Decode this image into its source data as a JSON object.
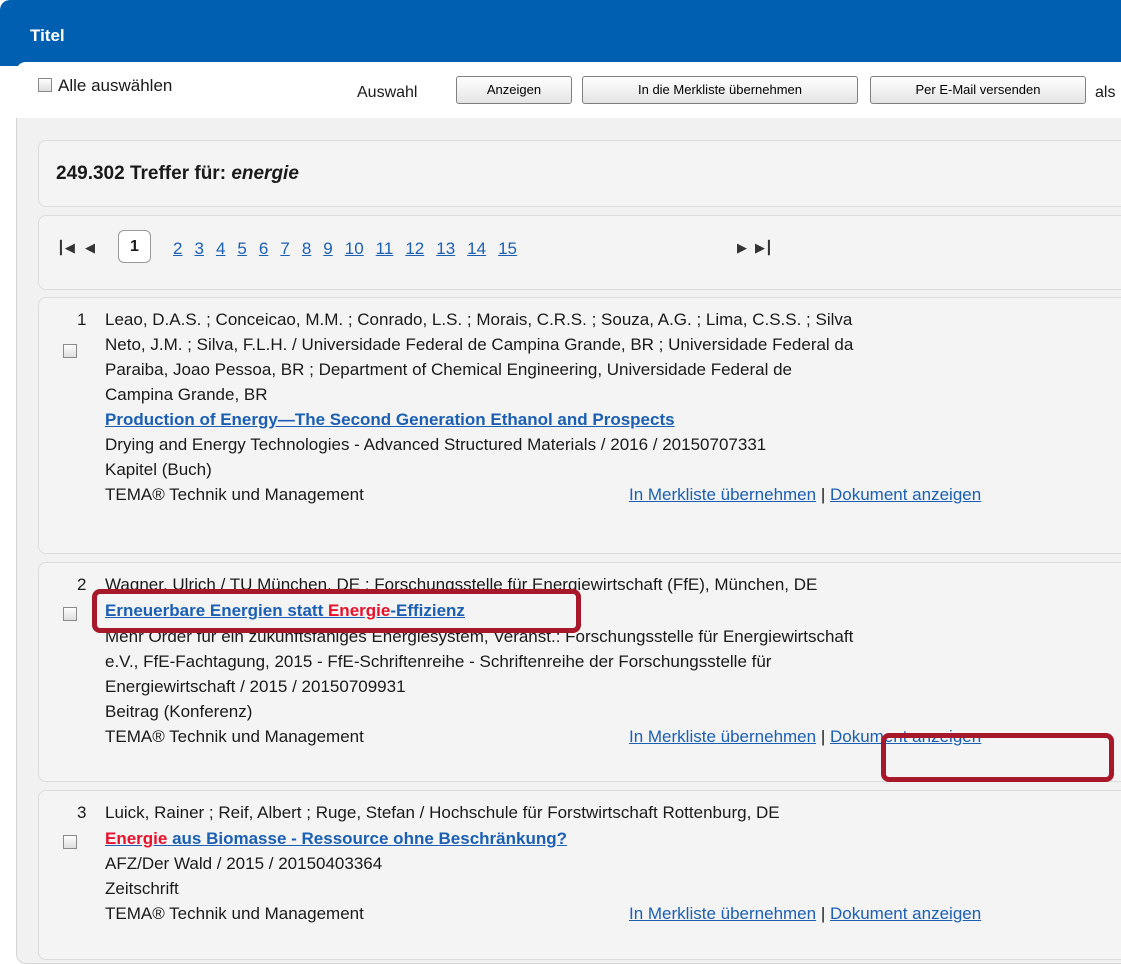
{
  "header": {
    "title": "Titel"
  },
  "toolbar": {
    "select_all_label": "Alle auswählen",
    "selection_label": "Auswahl",
    "show_button": "Anzeigen",
    "add_to_list_button": "In die Merkliste übernehmen",
    "email_button": "Per E-Mail versenden",
    "trailing_text": "als"
  },
  "search": {
    "hits_text": "249.302 Treffer für: ",
    "query": "energie"
  },
  "pagination": {
    "current": "1",
    "pages": [
      "2",
      "3",
      "4",
      "5",
      "6",
      "7",
      "8",
      "9",
      "10",
      "11",
      "12",
      "13",
      "14",
      "15"
    ],
    "first_icon": "first-page-icon",
    "prev_icon": "prev-page-icon",
    "next_icon": "next-page-icon",
    "last_icon": "last-page-icon"
  },
  "results": [
    {
      "number": "1",
      "authors_line1": "Leao, D.A.S. ; Conceicao, M.M. ; Conrado, L.S. ; Morais, C.R.S. ; Souza, A.G. ; Lima, C.S.S. ; Silva",
      "authors_line2": "Neto, J.M. ; Silva, F.L.H. / Universidade Federal de Campina Grande, BR ; Universidade Federal da",
      "authors_line3": "Paraiba, Joao Pessoa, BR ; Department of Chemical Engineering, Universidade Federal de",
      "authors_line4": "Campina Grande, BR",
      "title": "Production of Energy—The Second Generation Ethanol and Prospects",
      "source": "Drying and Energy Technologies - Advanced Structured Materials / 2016 / 20150707331",
      "doc_type": "Kapitel (Buch)",
      "database": "TEMA® Technik und Management",
      "add_link": "In Merkliste übernehmen",
      "separator": "|",
      "show_link": "Dokument anzeigen"
    },
    {
      "number": "2",
      "authors_line1": "Wagner, Ulrich / TU München, DE ; Forschungsstelle für Energiewirtschaft (FfE), München, DE",
      "title_part1": "Erneuerbare Energien statt ",
      "title_highlight": "Energie",
      "title_part2": "-Effizienz",
      "source_line1": "Mehr Order für ein zukunftsfähiges Energiesystem, Veranst.: Forschungsstelle für Energiewirtschaft",
      "source_line2": "e.V., FfE-Fachtagung, 2015 - FfE-Schriftenreihe - Schriftenreihe der Forschungsstelle für",
      "source_line3": "Energiewirtschaft / 2015 / 20150709931",
      "doc_type": "Beitrag (Konferenz)",
      "database": "TEMA® Technik und Management",
      "add_link": "In Merkliste übernehmen",
      "separator": "|",
      "show_link": "Dokument anzeigen"
    },
    {
      "number": "3",
      "authors_line1": "Luick, Rainer ; Reif, Albert ; Ruge, Stefan / Hochschule für Forstwirtschaft Rottenburg, DE",
      "title_highlight": "Energie",
      "title_part2": " aus Biomasse - Ressource ohne Beschränkung?",
      "source": "AFZ/Der Wald / 2015 / 20150403364",
      "doc_type": "Zeitschrift",
      "database": "TEMA® Technik und Management",
      "add_link": "In Merkliste übernehmen",
      "separator": "|",
      "show_link": "Dokument anzeigen"
    }
  ],
  "colors": {
    "header": "#005fb0",
    "link": "#1a5fb4",
    "highlight": "#e8102a",
    "annotation": "#a8182b"
  }
}
